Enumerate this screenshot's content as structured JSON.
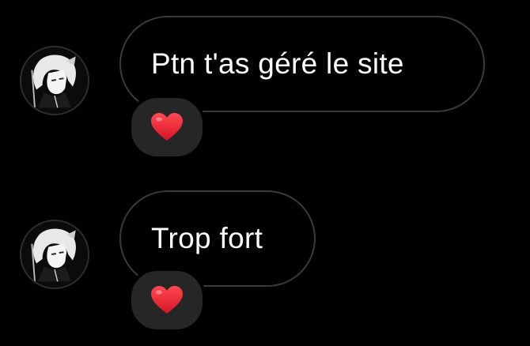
{
  "messages": [
    {
      "text": "Ptn t'as géré le site",
      "reaction": "red-heart",
      "avatar": "anime-character-avatar"
    },
    {
      "text": "Trop fort",
      "reaction": "red-heart",
      "avatar": "anime-character-avatar"
    }
  ],
  "colors": {
    "background": "#000000",
    "bubble_border": "#3a3a3a",
    "text": "#ffffff",
    "reaction_bg": "#262626",
    "heart": "#e0202c"
  }
}
